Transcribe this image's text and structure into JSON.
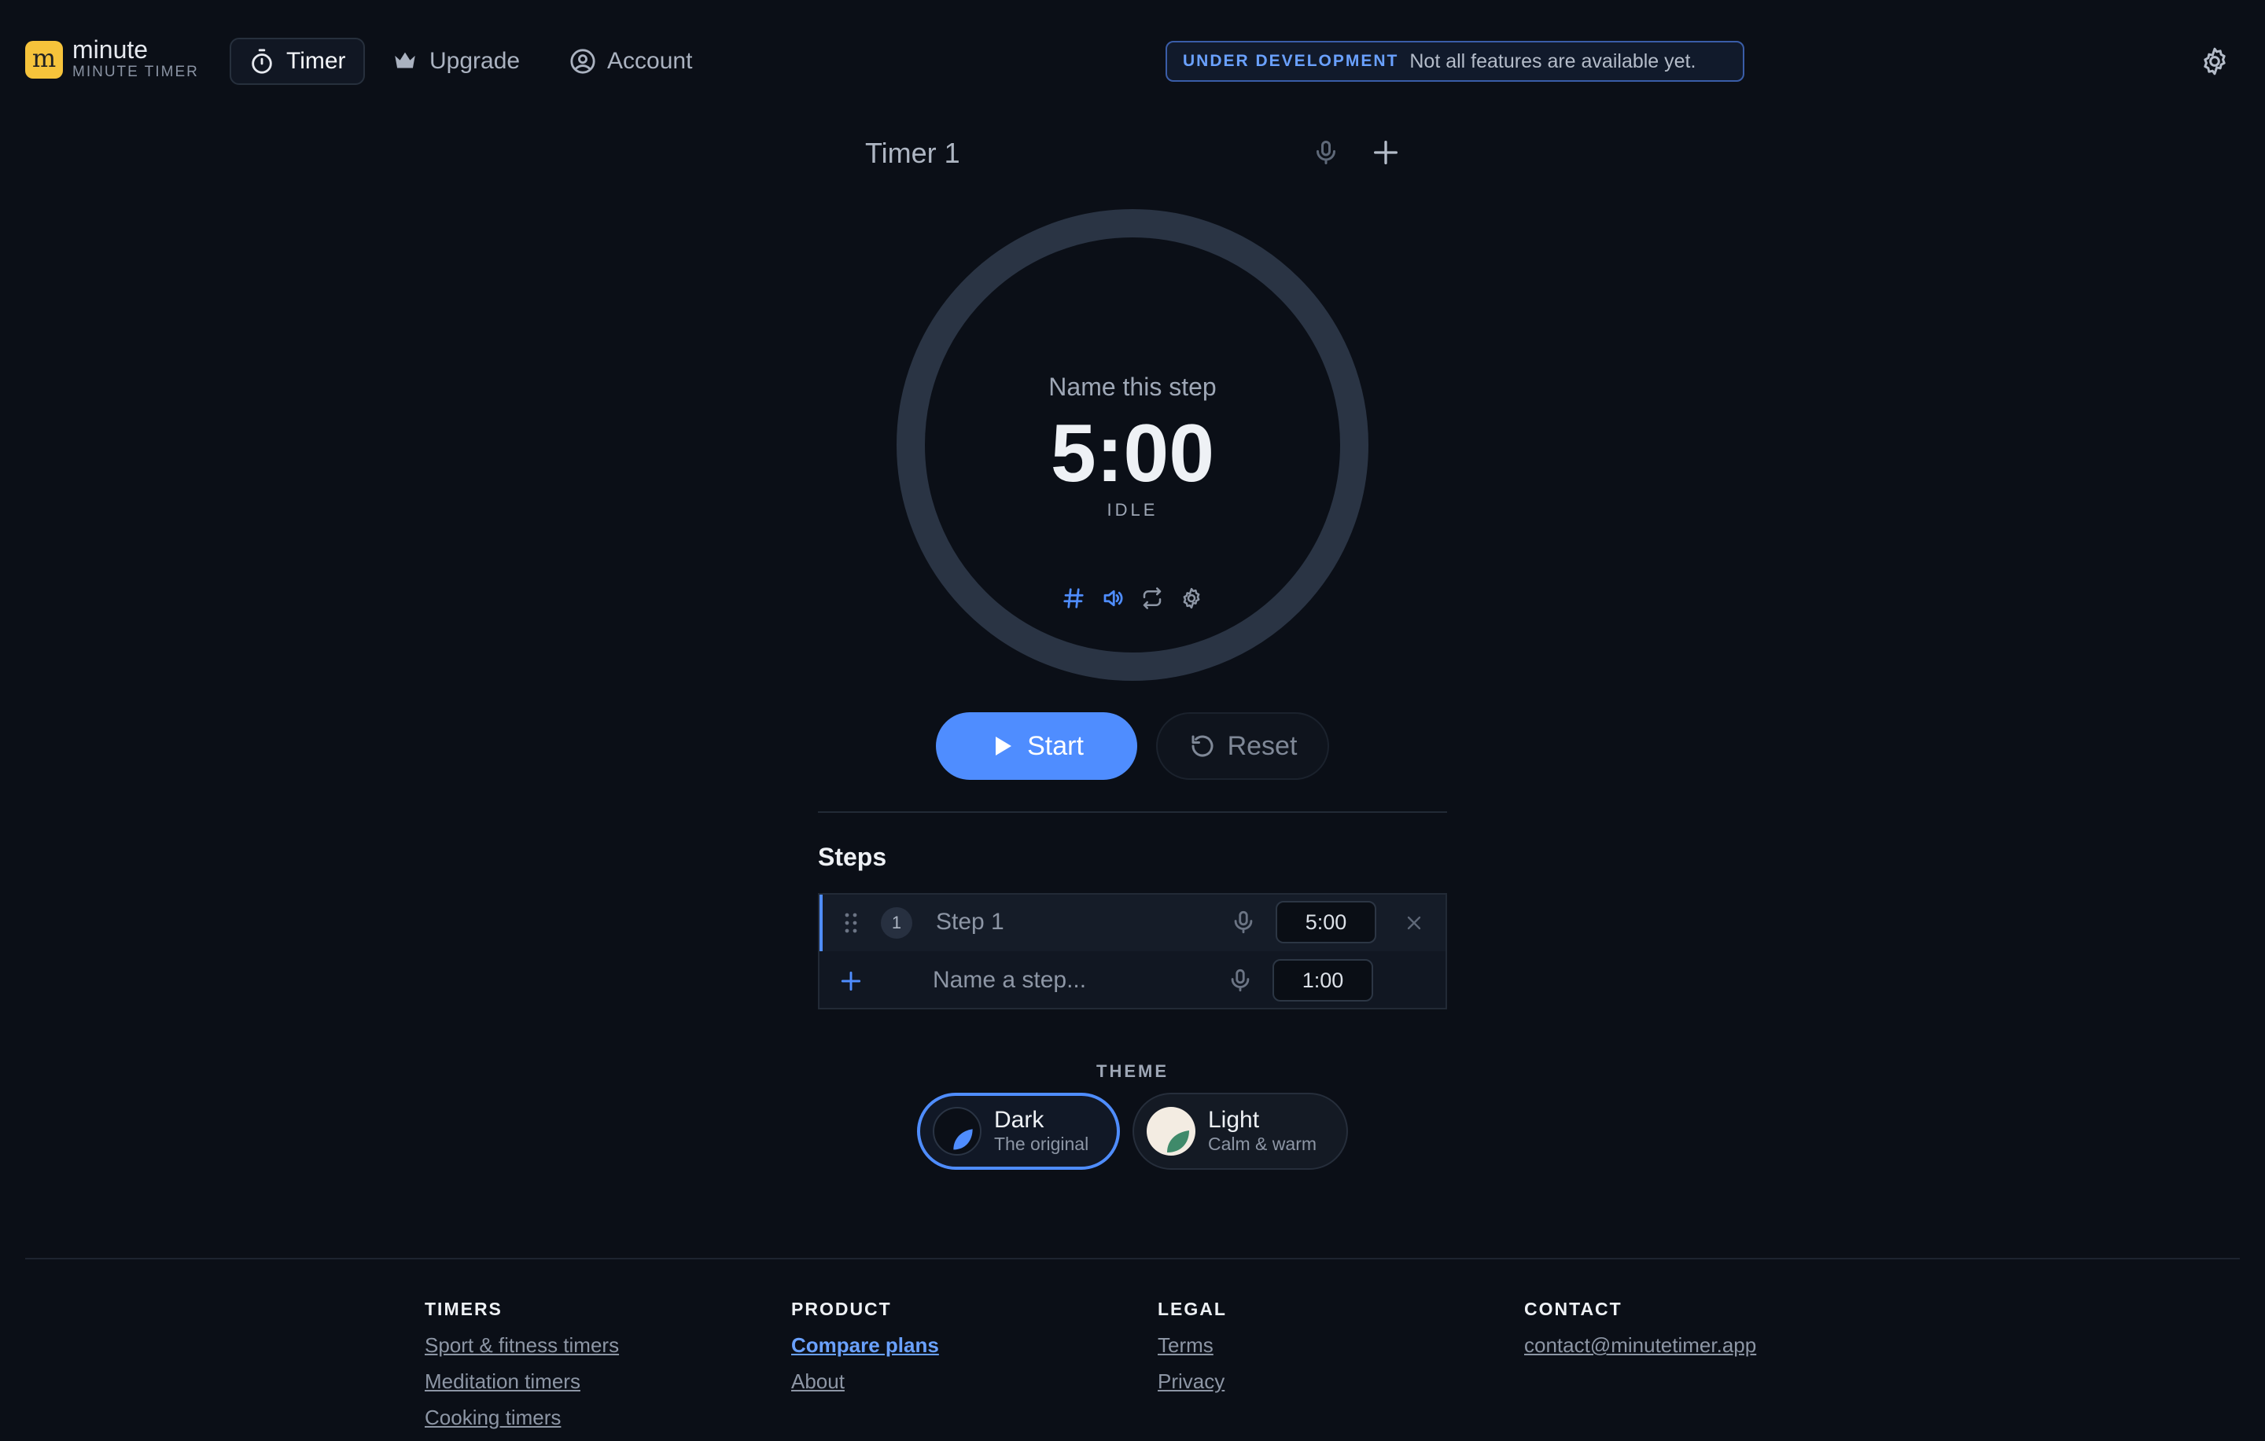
{
  "header": {
    "logo_letter": "m",
    "brand_name": "minute",
    "brand_sub": "MINUTE TIMER",
    "nav": [
      {
        "label": "Timer",
        "icon": "stopwatch-icon",
        "active": true
      },
      {
        "label": "Upgrade",
        "icon": "crown-icon",
        "active": false
      },
      {
        "label": "Account",
        "icon": "user-circle-icon",
        "active": false
      }
    ],
    "banner_tag": "UNDER DEVELOPMENT",
    "banner_text": "Not all features are available yet."
  },
  "timer": {
    "title": "Timer 1",
    "step_name": "Name this step",
    "time": "5:00",
    "state": "IDLE",
    "icons": [
      "hash-icon",
      "volume-icon",
      "repeat-icon",
      "gear-icon"
    ]
  },
  "controls": {
    "start_label": "Start",
    "reset_label": "Reset"
  },
  "steps": {
    "heading": "Steps",
    "items": [
      {
        "number": "1",
        "label": "Step 1",
        "duration": "5:00"
      }
    ],
    "new_step": {
      "placeholder": "Name a step...",
      "duration": "1:00"
    }
  },
  "theme": {
    "label": "THEME",
    "options": [
      {
        "name": "Dark",
        "sub": "The original",
        "selected": true
      },
      {
        "name": "Light",
        "sub": "Calm & warm",
        "selected": false
      }
    ]
  },
  "footer": {
    "columns": [
      {
        "heading": "TIMERS",
        "links": [
          "Sport & fitness timers",
          "Meditation timers",
          "Cooking timers"
        ]
      },
      {
        "heading": "PRODUCT",
        "links": [
          "Compare plans",
          "About"
        ]
      },
      {
        "heading": "LEGAL",
        "links": [
          "Terms",
          "Privacy"
        ]
      },
      {
        "heading": "CONTACT",
        "links": [
          "contact@minutetimer.app"
        ]
      }
    ]
  },
  "colors": {
    "background": "#0b0f17",
    "accent": "#4f8dff",
    "logo": "#f6c33b",
    "dial_track": "#2a3444"
  }
}
